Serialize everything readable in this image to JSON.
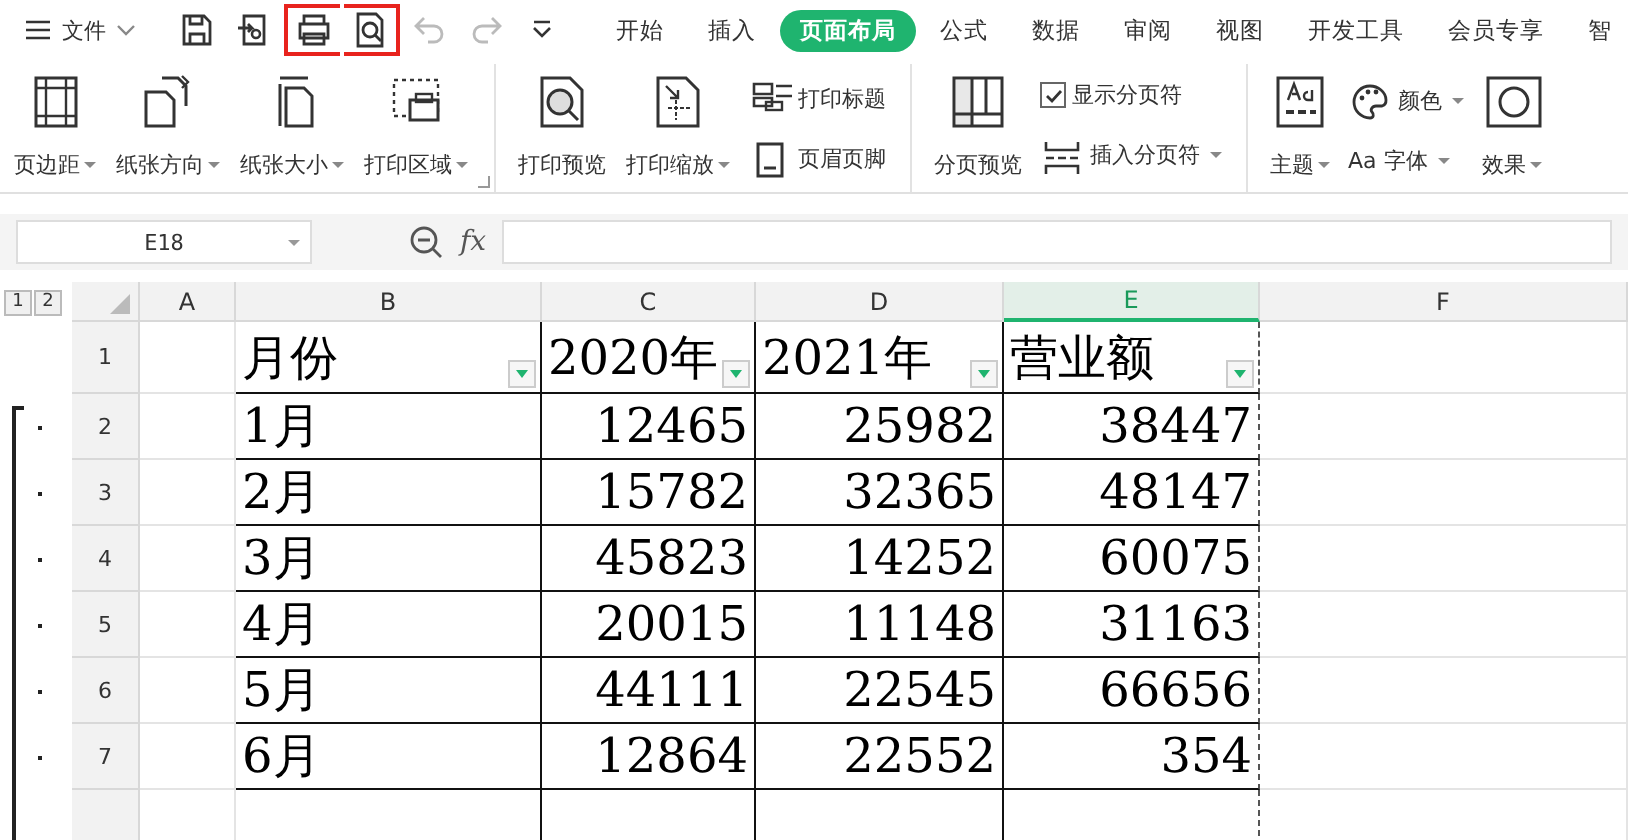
{
  "menu": {
    "label": "文件"
  },
  "quick_tools": [
    {
      "kind": "save",
      "highlighted": false,
      "disabled": false
    },
    {
      "kind": "export",
      "highlighted": false,
      "disabled": false
    },
    {
      "kind": "print",
      "highlighted": true,
      "disabled": false
    },
    {
      "kind": "preview",
      "highlighted": true,
      "disabled": false
    },
    {
      "kind": "undo",
      "highlighted": false,
      "disabled": true
    },
    {
      "kind": "redo",
      "highlighted": false,
      "disabled": true
    },
    {
      "kind": "more",
      "highlighted": false,
      "disabled": false
    }
  ],
  "tabs": [
    {
      "label": "开始",
      "selected": false
    },
    {
      "label": "插入",
      "selected": false
    },
    {
      "label": "页面布局",
      "selected": true
    },
    {
      "label": "公式",
      "selected": false
    },
    {
      "label": "数据",
      "selected": false
    },
    {
      "label": "审阅",
      "selected": false
    },
    {
      "label": "视图",
      "selected": false
    },
    {
      "label": "开发工具",
      "selected": false
    },
    {
      "label": "会员专享",
      "selected": false
    },
    {
      "label": "智",
      "selected": false
    }
  ],
  "ribbon_groups": [
    {
      "items": [
        {
          "kind": "large",
          "label": "页边距",
          "dropdown": true
        },
        {
          "kind": "large",
          "label": "纸张方向",
          "dropdown": true
        },
        {
          "kind": "large",
          "label": "纸张大小",
          "dropdown": true
        },
        {
          "kind": "large",
          "label": "打印区域",
          "dropdown": true
        }
      ]
    },
    {
      "items": [
        {
          "kind": "large",
          "label": "打印预览",
          "dropdown": false
        },
        {
          "kind": "large",
          "label": "打印缩放",
          "dropdown": true
        },
        {
          "kind": "small",
          "label": "打印标题",
          "dropdown": false
        },
        {
          "kind": "small",
          "label": "页眉页脚",
          "dropdown": false
        }
      ]
    },
    {
      "items": [
        {
          "kind": "large",
          "label": "分页预览",
          "dropdown": false
        },
        {
          "kind": "check",
          "label": "显示分页符",
          "checked": true
        },
        {
          "kind": "small",
          "label": "插入分页符",
          "dropdown": true
        }
      ]
    },
    {
      "items": [
        {
          "kind": "large",
          "label": "主题",
          "dropdown": true
        },
        {
          "kind": "small",
          "label": "颜色",
          "dropdown": true
        },
        {
          "kind": "small",
          "label": "字体",
          "dropdown": true,
          "prefix": "Aa"
        },
        {
          "kind": "large",
          "label": "效果",
          "dropdown": true
        }
      ]
    }
  ],
  "formula_bar": {
    "name_box": "E18",
    "fx": "fx"
  },
  "outline_levels": [
    "1",
    "2"
  ],
  "columns": [
    {
      "label": "A",
      "selected": false
    },
    {
      "label": "B",
      "selected": false
    },
    {
      "label": "C",
      "selected": false
    },
    {
      "label": "D",
      "selected": false
    },
    {
      "label": "E",
      "selected": true
    },
    {
      "label": "F",
      "selected": false
    }
  ],
  "rows": [
    {
      "number": "1",
      "header": true,
      "grouped": false,
      "cells": [
        "",
        "月份",
        "2020年",
        "2021年",
        "营业额",
        ""
      ]
    },
    {
      "number": "2",
      "header": false,
      "grouped": true,
      "cells": [
        "",
        "1月",
        "12465",
        "25982",
        "38447",
        ""
      ]
    },
    {
      "number": "3",
      "header": false,
      "grouped": true,
      "cells": [
        "",
        "2月",
        "15782",
        "32365",
        "48147",
        ""
      ]
    },
    {
      "number": "4",
      "header": false,
      "grouped": true,
      "cells": [
        "",
        "3月",
        "45823",
        "14252",
        "60075",
        ""
      ]
    },
    {
      "number": "5",
      "header": false,
      "grouped": true,
      "cells": [
        "",
        "4月",
        "20015",
        "11148",
        "31163",
        ""
      ]
    },
    {
      "number": "6",
      "header": false,
      "grouped": true,
      "cells": [
        "",
        "5月",
        "44111",
        "22545",
        "66656",
        ""
      ]
    },
    {
      "number": "7",
      "header": false,
      "grouped": true,
      "cells": [
        "",
        "6月",
        "12864",
        "22552",
        "354",
        ""
      ]
    }
  ]
}
